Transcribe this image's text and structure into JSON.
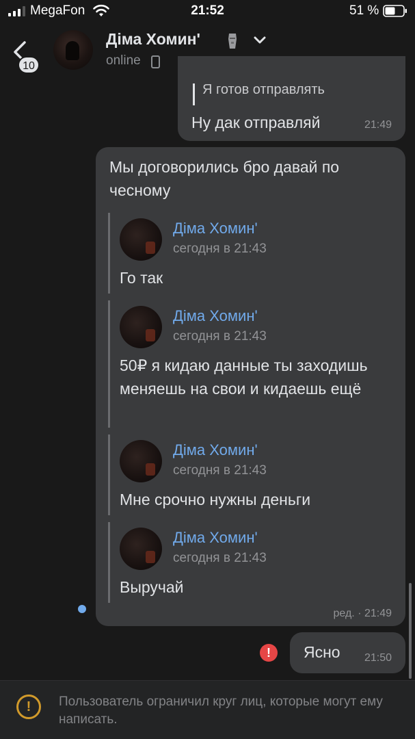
{
  "status_bar": {
    "carrier": "MegaFon",
    "time": "21:52",
    "battery_percent": "51 %"
  },
  "header": {
    "unread_count": "10",
    "contact_name": "Діма Хомин'",
    "status": "online"
  },
  "messages": {
    "top": {
      "quote": "Я готов отправлять",
      "text": "Ну дак отправляй",
      "time": "21:49"
    },
    "main": {
      "text": "Мы договорились бро давай по чесному",
      "forwarded": [
        {
          "author": "Діма Хомин'",
          "date": "сегодня в 21:43",
          "text": "Го так"
        },
        {
          "author": "Діма Хомин'",
          "date": "сегодня в 21:43",
          "text": "50₽ я кидаю данные ты заходишь меняешь на свои и кидаешь ещё"
        },
        {
          "author": "Діма Хомин'",
          "date": "сегодня в 21:43",
          "text": "Мне срочно нужны деньги"
        },
        {
          "author": "Діма Хомин'",
          "date": "сегодня в 21:43",
          "text": "Выручай"
        }
      ],
      "time": "ред. · 21:49"
    },
    "last": {
      "text": "Ясно",
      "time": "21:50",
      "error_mark": "!"
    }
  },
  "restriction": {
    "icon_glyph": "!",
    "text": "Пользователь ограничил круг лиц, которые могут ему написать."
  },
  "colors": {
    "background": "#191919",
    "bubble": "#3a3b3d",
    "link_blue": "#71aaeb",
    "error_red": "#e64646",
    "warning_orange": "#d19a2b"
  }
}
